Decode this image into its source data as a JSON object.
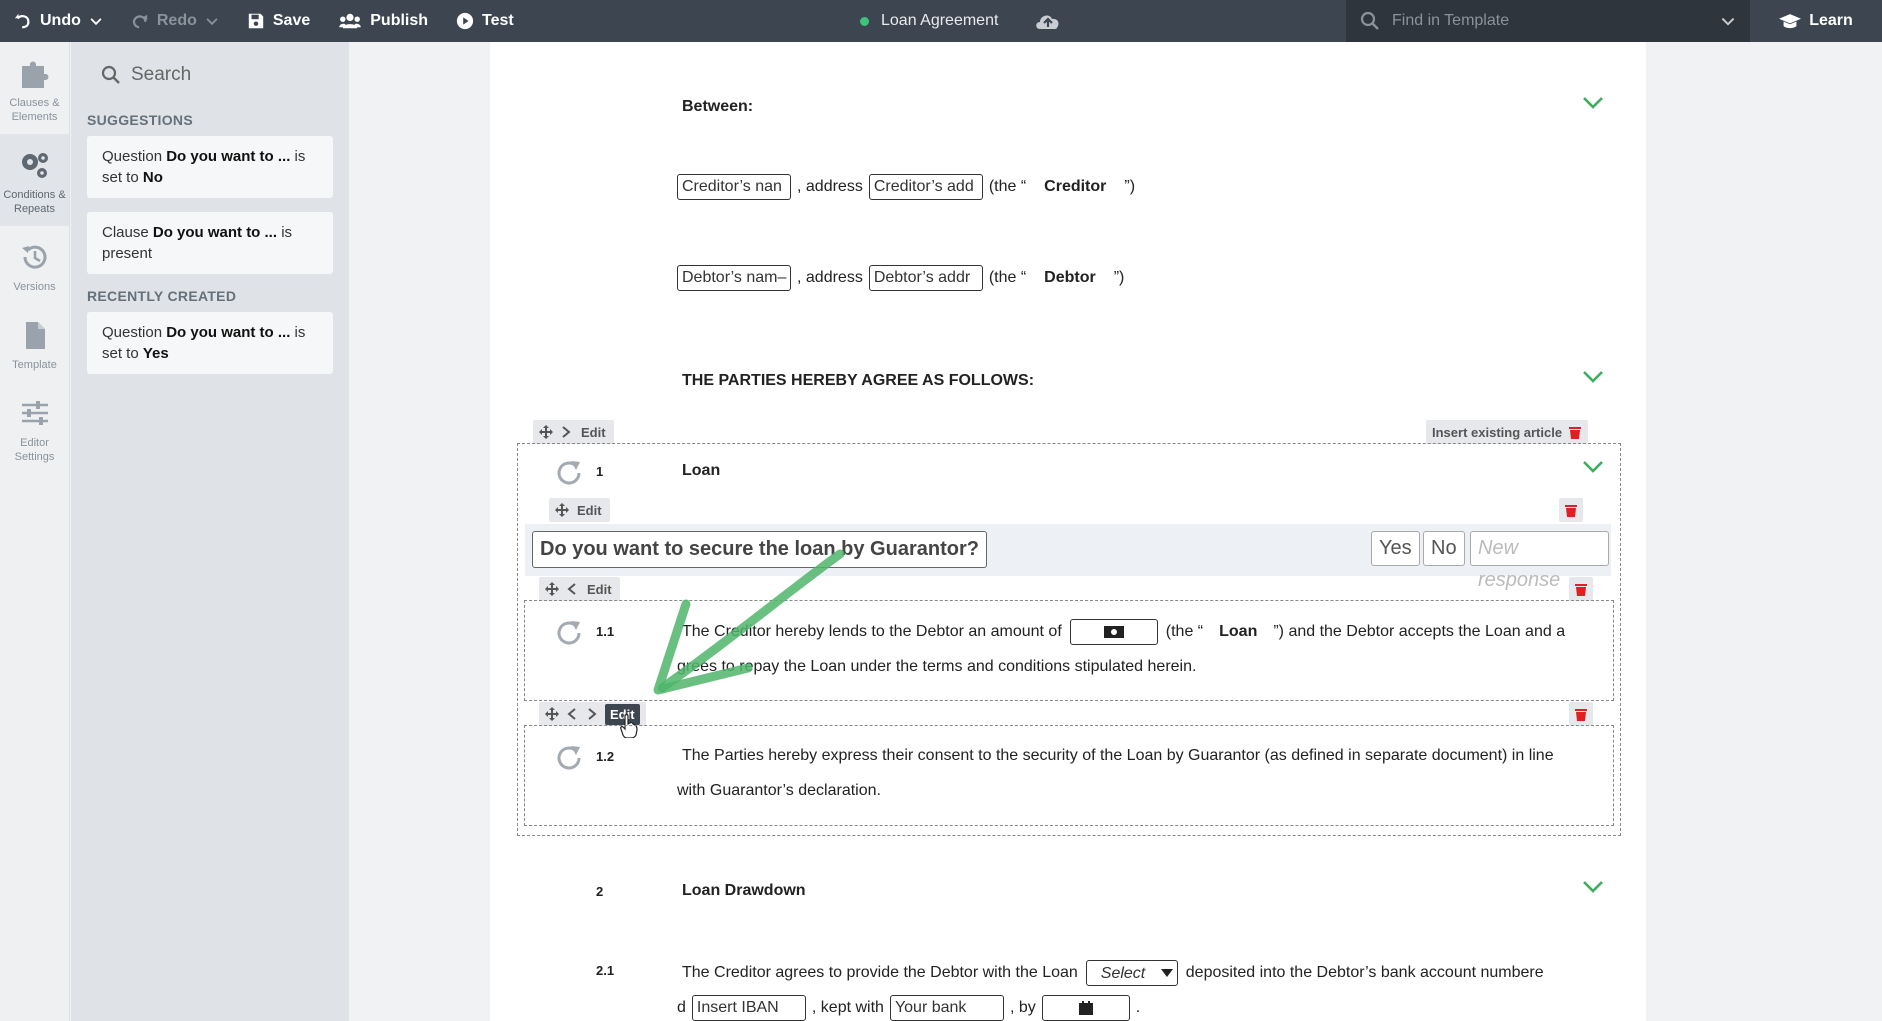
{
  "toolbar": {
    "undo": "Undo",
    "redo": "Redo",
    "save": "Save",
    "publish": "Publish",
    "test": "Test",
    "doc_title": "Loan Agreement",
    "search_placeholder": "Find in Template",
    "learn": "Learn",
    "status_color": "#3fc27a"
  },
  "rail": {
    "items": [
      {
        "label1": "Clauses &",
        "label2": "Elements",
        "icon": "puzzle-icon"
      },
      {
        "label1": "Conditions &",
        "label2": "Repeats",
        "icon": "gears-icon"
      },
      {
        "label1": "Versions",
        "label2": "",
        "icon": "history-icon"
      },
      {
        "label1": "Template",
        "label2": "",
        "icon": "file-icon"
      },
      {
        "label1": "Editor",
        "label2": "Settings",
        "icon": "sliders-icon"
      }
    ]
  },
  "panel": {
    "search_placeholder": "Search",
    "suggestions_heading": "SUGGESTIONS",
    "recent_heading": "RECENTLY CREATED",
    "suggestions": [
      {
        "pre": "Question ",
        "name": "Do you want to ...",
        "mid": " is set to ",
        "val": "No"
      },
      {
        "pre": "Clause ",
        "name": "Do you want to ...",
        "mid": " is present",
        "val": ""
      }
    ],
    "recent": [
      {
        "pre": "Question ",
        "name": "Do you want to ...",
        "mid": " is set to ",
        "val": "Yes"
      }
    ]
  },
  "doc": {
    "between": "Between:",
    "creditor_name": "Creditor’s nan",
    "creditor_addr": "Creditor’s add",
    "address_word": ", address",
    "the_open": "(the “",
    "the_close": "”)",
    "creditor_label": "Creditor",
    "debtor_name": "Debtor’s nam–",
    "debtor_addr": "Debtor’s addr",
    "debtor_label": "Debtor",
    "agree_heading": "THE PARTIES HEREBY AGREE AS FOLLOWS:",
    "edit": "Edit",
    "insert_article": "Insert existing article",
    "article1_num": "1",
    "article1_title": "Loan",
    "question": "Do you want to secure the loan by Guarantor?",
    "resp_yes": "Yes",
    "resp_no": "No",
    "resp_new": "New response",
    "c11_num": "1.1",
    "c11_a": "The Creditor hereby lends to the Debtor an amount of",
    "c11_loan": "Loan",
    "c11_b": "”) and the Debtor accepts the Loan and a",
    "c11_c": "grees to repay the Loan under the terms and conditions stipulated herein.",
    "c12_num": "1.2",
    "c12_a": "The Parties hereby express their consent to the security of the Loan by Guarantor (as defined in separate document) in line",
    "c12_b": "with Guarantor’s declaration.",
    "article2_num": "2",
    "article2_title": "Loan Drawdown",
    "c21_num": "2.1",
    "c21_a": "The Creditor agrees to provide the Debtor with the Loan",
    "c21_select": "Select",
    "c21_b": "deposited into the Debtor’s bank account numbere",
    "c21_d": "d",
    "c21_iban": "Insert IBAN",
    "c21_kept": ", kept with",
    "c21_bank": "Your bank",
    "c21_by": ", by",
    "c21_end": "."
  }
}
